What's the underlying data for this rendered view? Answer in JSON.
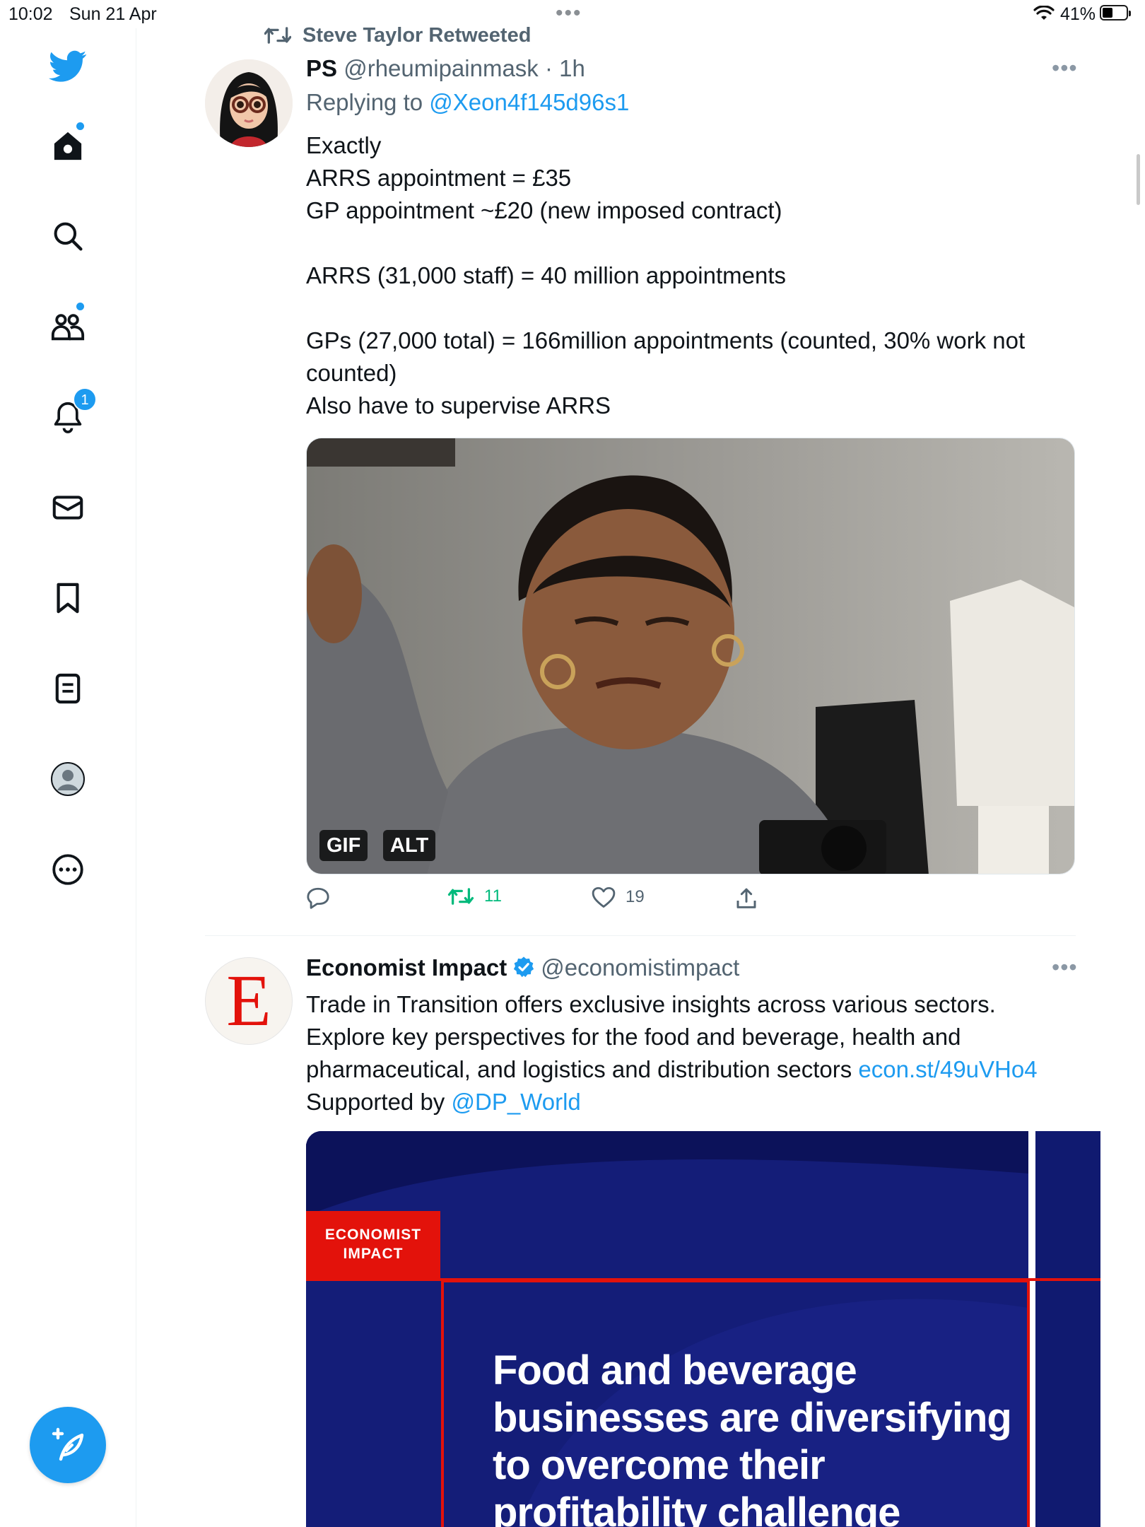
{
  "status_bar": {
    "time": "10:02",
    "date": "Sun 21 Apr",
    "battery": "41%"
  },
  "sidebar": {
    "items": [
      {
        "icon": "twitter-bird-icon"
      },
      {
        "icon": "home-icon",
        "dot": true
      },
      {
        "icon": "search-icon"
      },
      {
        "icon": "communities-icon",
        "dot": true
      },
      {
        "icon": "notifications-bell-icon",
        "badge": "1"
      },
      {
        "icon": "mail-icon"
      },
      {
        "icon": "bookmark-icon"
      },
      {
        "icon": "lists-icon"
      },
      {
        "icon": "profile-avatar-icon"
      },
      {
        "icon": "more-circle-icon"
      }
    ],
    "compose_icon": "compose-feather-plus-icon"
  },
  "tweets": [
    {
      "retweeted_by": "Steve Taylor Retweeted",
      "name": "PS",
      "handle": "@rheumipainmask",
      "time": "· 1h",
      "reply_prefix": "Replying to",
      "reply_handle": "@Xeon4f145d96s1",
      "text": "Exactly\nARRS appointment = £35\nGP appointment ~£20 (new imposed contract)\n\nARRS (31,000 staff) = 40 million appointments\n\nGPs (27,000 total) = 166million appointments (counted, 30% work not counted)\nAlso have to supervise ARRS",
      "media_tags": [
        "GIF",
        "ALT"
      ],
      "actions": {
        "replies": "",
        "retweets": "11",
        "likes": "19"
      }
    },
    {
      "name": "Economist Impact",
      "handle": "@economistimpact",
      "avatar_letter": "E",
      "text_1": "Trade in Transition offers exclusive insights across various sectors. Explore key perspectives for the food and beverage, health and pharmaceutical, and logistics and distribution sectors ",
      "link": "econ.st/49uVHo4",
      "text_2": " Supported by ",
      "mention": "@DP_World",
      "card": {
        "brand": "ECONOMIST\nIMPACT",
        "headline": "Food and beverage businesses are diversifying to overcome their profitability challenge"
      }
    }
  ],
  "colors": {
    "accent": "#1d9bf0",
    "retweet_green": "#00ba7c",
    "economist_red": "#e3120b",
    "card_navy": "#121a6e"
  }
}
